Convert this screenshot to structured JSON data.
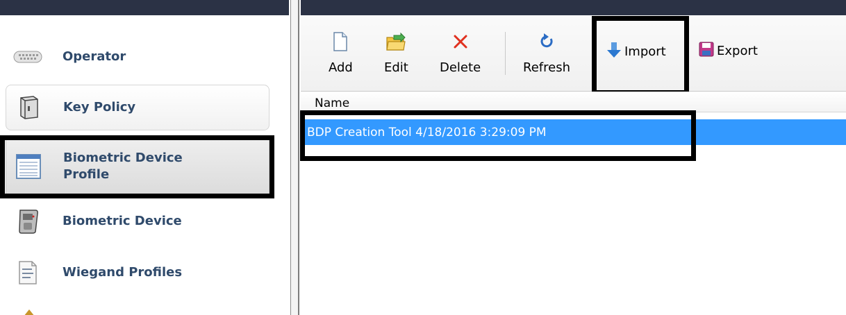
{
  "sidebar": {
    "items": [
      {
        "label": "Operator",
        "icon": "keyboard-icon"
      },
      {
        "label": "Key Policy",
        "icon": "safe-icon"
      },
      {
        "label": "Biometric Device\nProfile",
        "icon": "profile-list-icon"
      },
      {
        "label": "Biometric Device",
        "icon": "fingerprint-reader-icon"
      },
      {
        "label": "Wiegand Profiles",
        "icon": "binary-document-icon"
      }
    ]
  },
  "toolbar": {
    "add_label": "Add",
    "edit_label": "Edit",
    "delete_label": "Delete",
    "refresh_label": "Refresh",
    "import_label": "Import",
    "export_label": "Export"
  },
  "grid": {
    "columns": [
      "Name"
    ],
    "rows": [
      {
        "name": "BDP Creation Tool 4/18/2016 3:29:09 PM",
        "selected": true
      }
    ]
  },
  "colors": {
    "nav_text": "#2f4a6b",
    "selection": "#3399ff",
    "title_bar": "#2b3245",
    "annotation": "#000000"
  }
}
